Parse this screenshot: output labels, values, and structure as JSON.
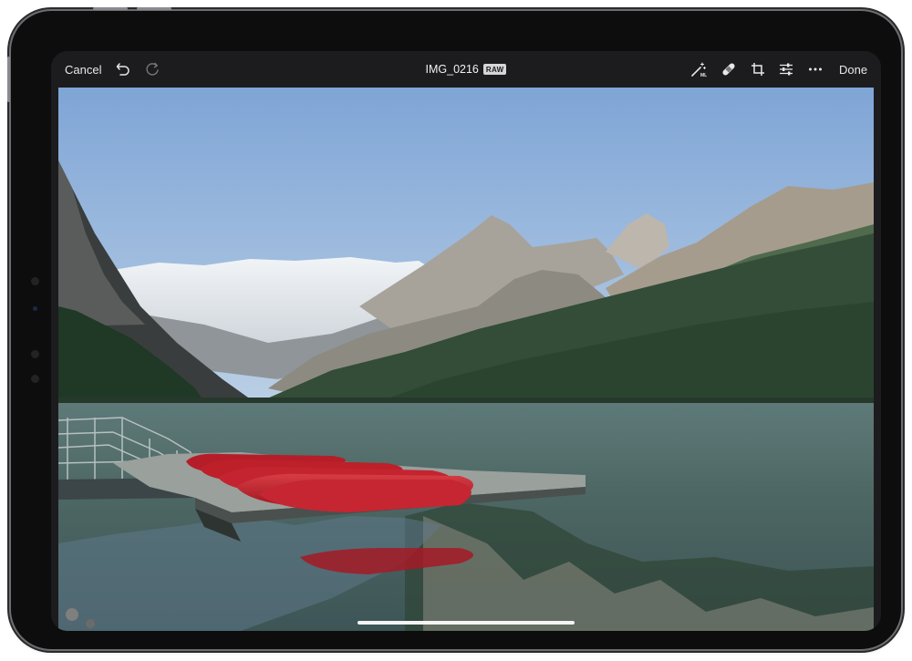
{
  "toolbar": {
    "cancel_label": "Cancel",
    "undo_icon": "undo-icon",
    "redo_icon": "redo-icon",
    "title": "IMG_0216",
    "badge": "RAW",
    "tools": [
      "magic-wand-ml-icon",
      "bandage-icon",
      "crop-icon",
      "sliders-icon",
      "more-icon"
    ],
    "done_label": "Done"
  },
  "photo": {
    "subject": "lake with red canoes on dock and mountains",
    "colors": {
      "sky_top": "#7fa5d6",
      "sky_bottom": "#bcd1e6",
      "forest": "#2f4a34",
      "water": "#56706d",
      "canoe": "#c2232d",
      "dock": "#8f9794"
    }
  },
  "colors": {
    "bezel": "#0d0d0e",
    "toolbar_bg": "#1c1c1e",
    "toolbar_text": "#e8e8ea"
  }
}
